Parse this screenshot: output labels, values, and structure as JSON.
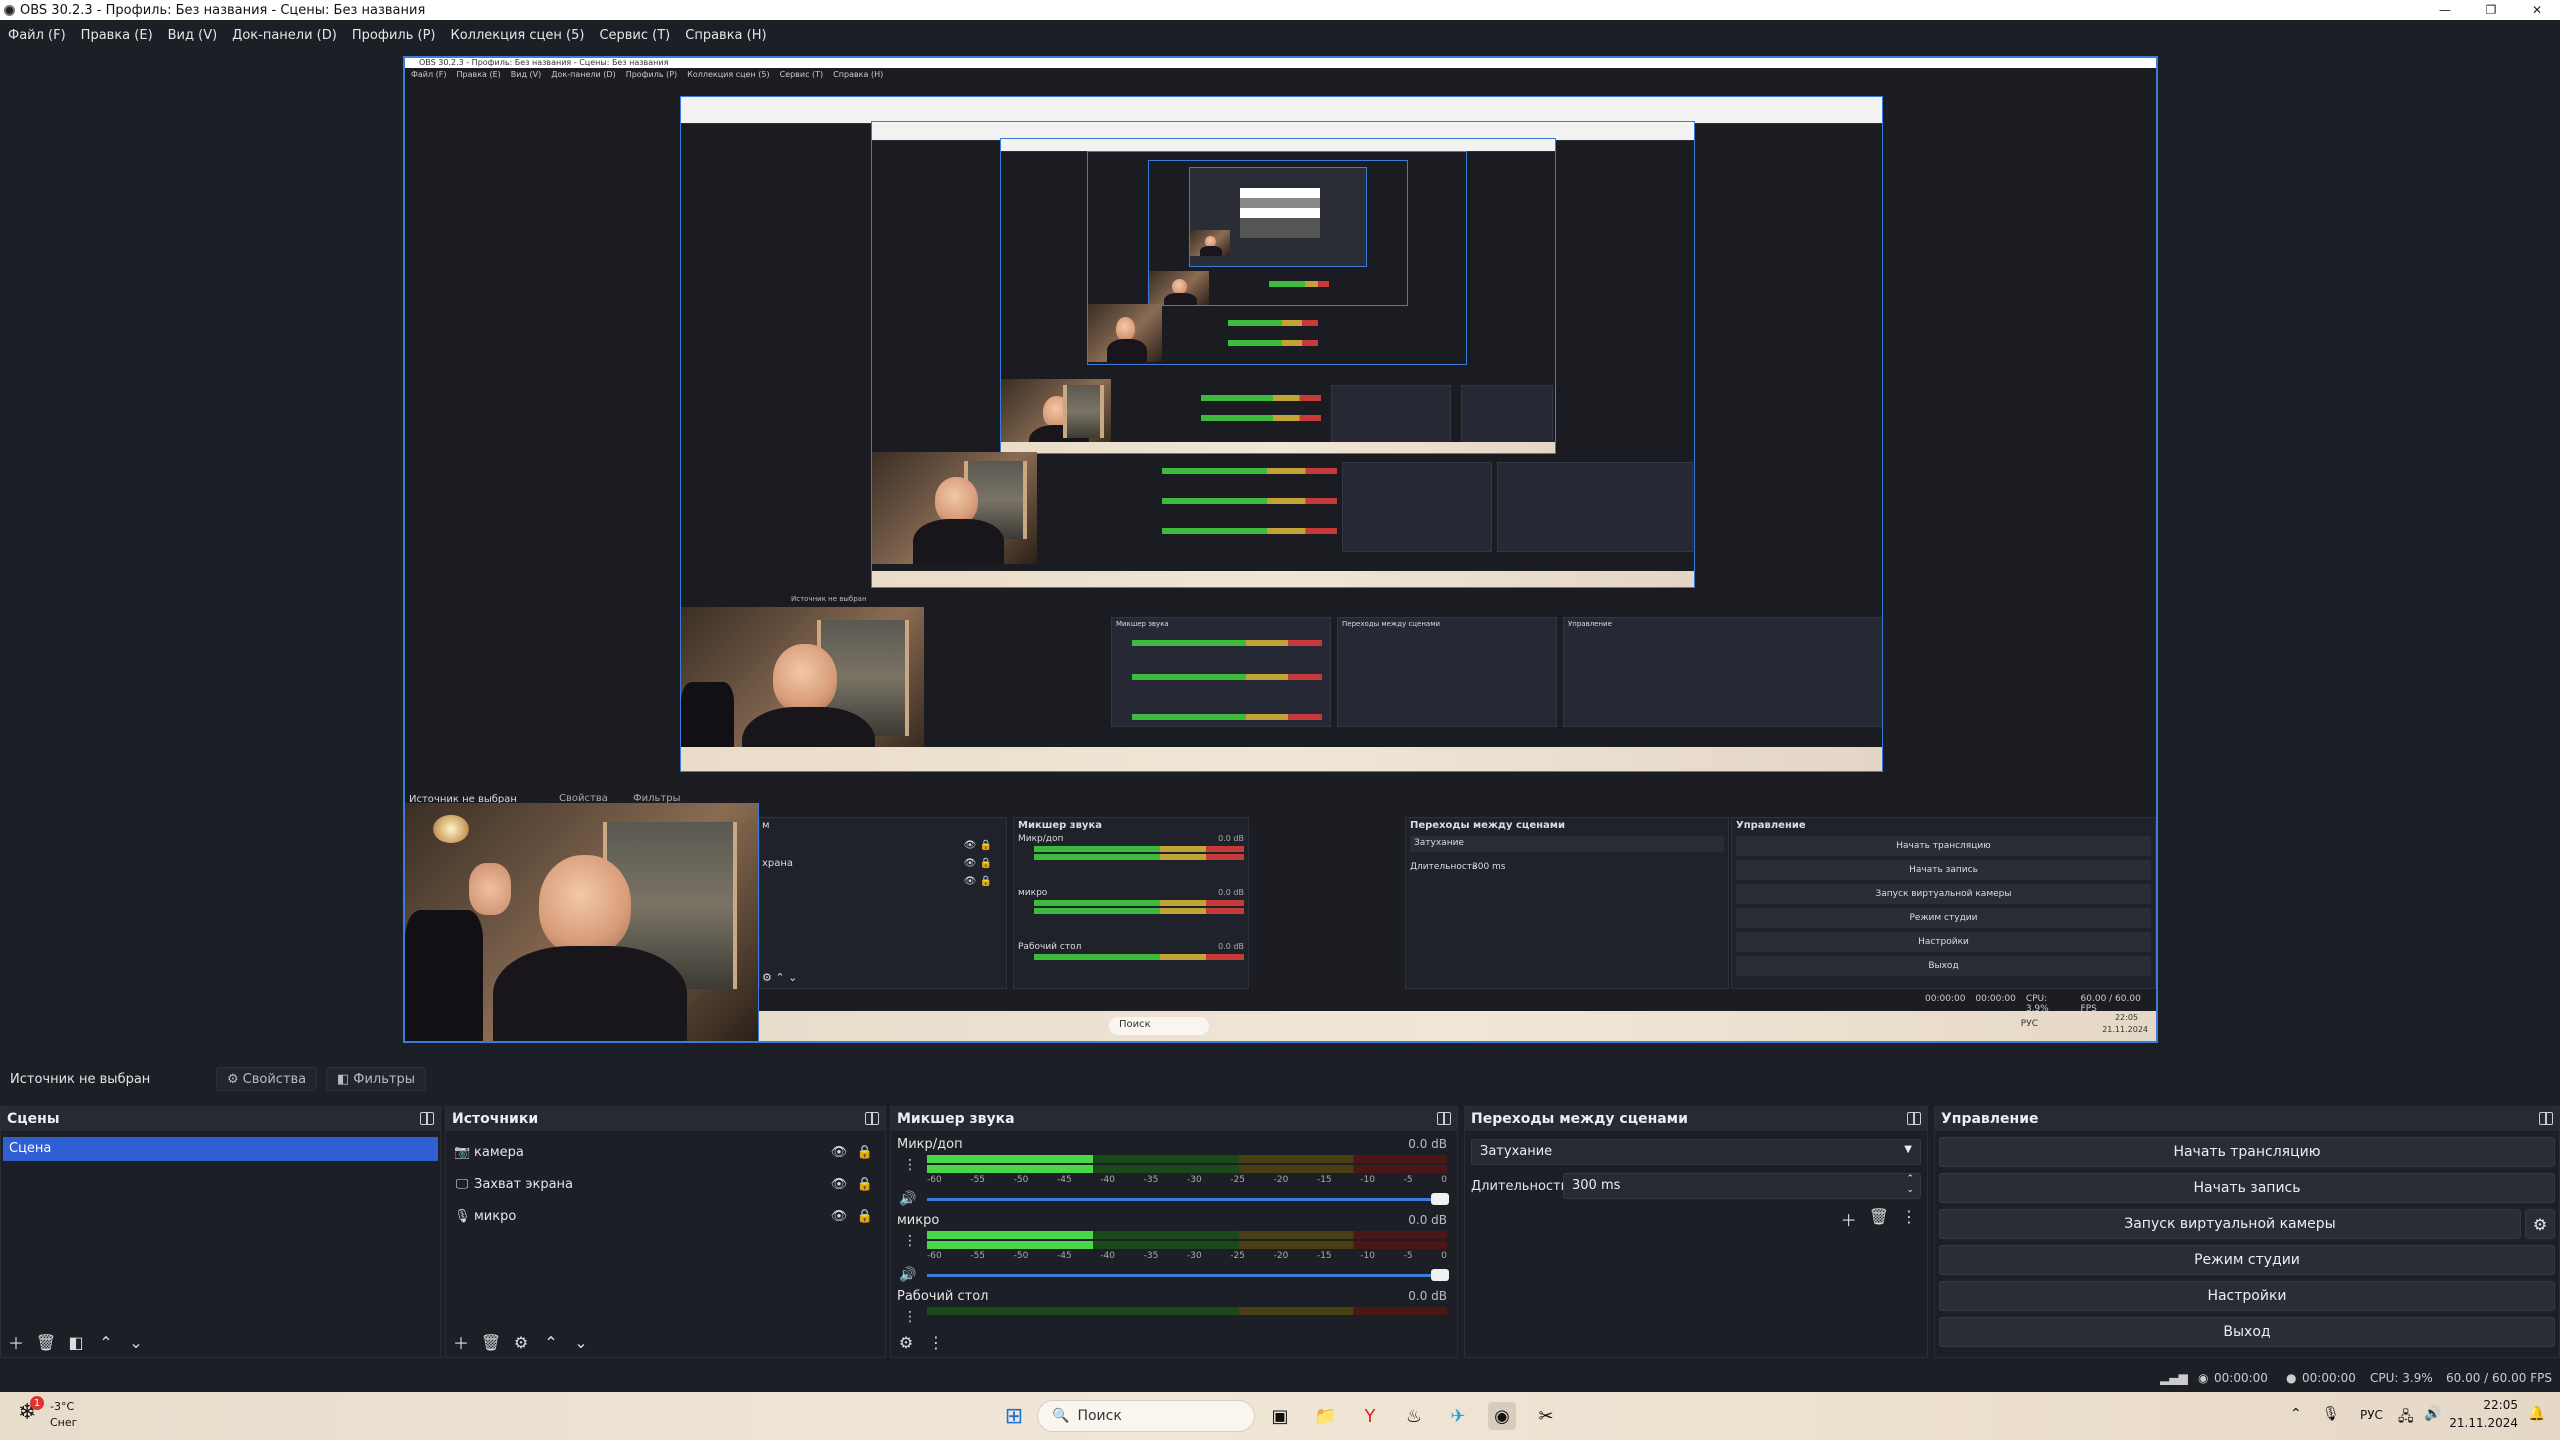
{
  "window": {
    "title": "OBS 30.2.3 - Профиль: Без названия - Сцены: Без названия",
    "controls": [
      "—",
      "❐",
      "✕"
    ]
  },
  "menu": [
    "Файл (F)",
    "Правка (E)",
    "Вид (V)",
    "Док-панели (D)",
    "Профиль (P)",
    "Коллекция сцен (5)",
    "Сервис (T)",
    "Справка (H)"
  ],
  "source_bar": {
    "status": "Источник не выбран",
    "properties": "Свойства",
    "filters": "Фильтры"
  },
  "scenes": {
    "title": "Сцены",
    "items": [
      "Сцена"
    ]
  },
  "sources": {
    "title": "Источники",
    "items": [
      {
        "icon": "camera-icon",
        "glyph": "📷",
        "label": "камера"
      },
      {
        "icon": "monitor-icon",
        "glyph": "🖵",
        "label": "Захват экрана"
      },
      {
        "icon": "microphone-icon",
        "glyph": "🎙",
        "label": "микро"
      }
    ]
  },
  "mixer": {
    "title": "Микшер звука",
    "channels": [
      {
        "name": "Микр/доп",
        "db": "0.0 dB",
        "level": 0.32
      },
      {
        "name": "микро",
        "db": "0.0 dB",
        "level": 0.32
      },
      {
        "name": "Рабочий стол",
        "db": "0.0 dB",
        "level": 0.0
      }
    ],
    "ticks": [
      "-60",
      "-55",
      "-50",
      "-45",
      "-40",
      "-35",
      "-30",
      "-25",
      "-20",
      "-15",
      "-10",
      "-5",
      "0"
    ]
  },
  "transitions": {
    "title": "Переходы между сценами",
    "selected": "Затухание",
    "duration_label": "Длительность",
    "duration_value": "300 ms"
  },
  "controls": {
    "title": "Управление",
    "buttons": [
      "Начать трансляцию",
      "Начать запись",
      "Запуск виртуальной камеры",
      "Режим студии",
      "Настройки",
      "Выход"
    ]
  },
  "status": {
    "stream_time": "00:00:00",
    "rec_time": "00:00:00",
    "cpu": "CPU: 3.9%",
    "fps": "60.00 / 60.00 FPS"
  },
  "taskbar": {
    "weather_temp": "-3°C",
    "weather_desc": "Снег",
    "weather_badge": "1",
    "search_placeholder": "Поиск",
    "lang": "РУС",
    "time": "22:05",
    "date": "21.11.2024"
  },
  "preview_nested": {
    "title": "OBS 30.2.3 - Профиль: Без названия - Сцены: Без названия",
    "menu": [
      "Файл (F)",
      "Правка (E)",
      "Вид (V)",
      "Док-панели (D)",
      "Профиль (P)",
      "Коллекция сцен (5)",
      "Сервис (T)",
      "Справка (H)"
    ],
    "source_status": "Источник не выбран",
    "props": "Свойства",
    "filters": "Фильтры",
    "scene_label_cut": "м",
    "capture_label_cut": "храна",
    "mixer_title": "Микшер звука",
    "ch1": "Микр/доп",
    "ch2": "микро",
    "ch3": "Рабочий стол",
    "db": "0.0 dB",
    "trans_title": "Переходы между сценами",
    "trans_sel": "Затухание",
    "dur_label": "Длительность",
    "dur_val": "300 ms",
    "ctrl_title": "Управление",
    "btn1": "Начать трансляцию",
    "btn2": "Начать запись",
    "btn3": "Запуск виртуальной камеры",
    "btn4": "Режим студии",
    "btn5": "Настройки",
    "btn6": "Выход",
    "cpu": "CPU: 3.9%",
    "fps": "60.00 / 60.00 FPS",
    "search": "Поиск",
    "lang": "РУС",
    "time": "22:05",
    "date": "21.11.2024",
    "stream_time": "00:00:00",
    "rec_time": "00:00:00"
  }
}
